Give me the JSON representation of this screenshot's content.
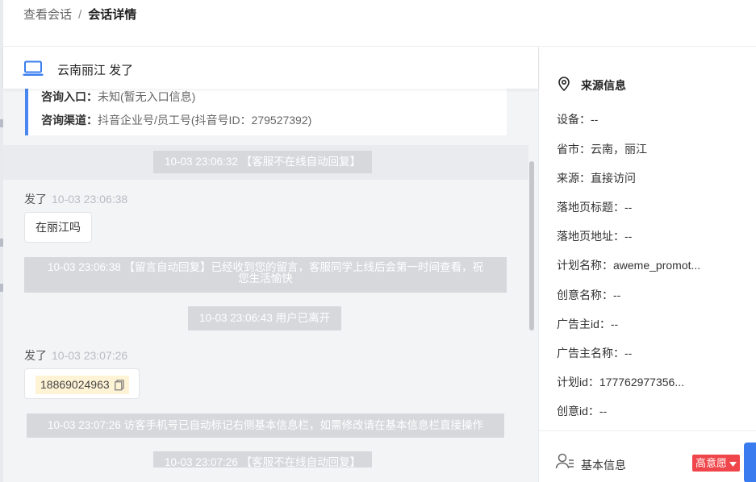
{
  "breadcrumb": {
    "parent": "查看会话",
    "separator": "/",
    "current": "会话详情"
  },
  "conversation": {
    "title": "云南丽江   发了",
    "entry_label": "咨询入口：",
    "entry_value": "未知(暂无入口信息)",
    "channel_label": "咨询渠道：",
    "channel_value": "抖音企业号/员工号(抖音号ID：279527392)",
    "messages": {
      "sys_1": "10-03 23:06:32 【客服不在线自动回复】",
      "sender_1": "发了",
      "time_1": "10-03 23:06:38",
      "bubble_1": "在丽江吗",
      "sys_2_line1": "10-03 23:06:38 【留言自动回复】已经收到您的留言，客服同学上线后会第一时间查看，祝",
      "sys_2_line2": "您生活愉快",
      "sys_3": "10-03 23:06:43 用户已离开",
      "sender_2": "发了",
      "time_2": "10-03 23:07:26",
      "phone": "18869024963",
      "sys_4": "10-03 23:07:26 访客手机号已自动标记右侧基本信息栏，如需修改请在基本信息栏直接操作",
      "sys_5": "10-03 23:07:26 【客服不在线自动回复】"
    }
  },
  "source_info": {
    "title": "来源信息",
    "device": "设备：--",
    "province_city": "省市：云南，丽江",
    "source": "来源：直接访问",
    "landing_title": "落地页标题：--",
    "landing_url": "落地页地址：--",
    "plan_name": "计划名称：aweme_promot...",
    "creative_name": "创意名称：--",
    "advertiser_id": "广告主id：--",
    "advertiser_name": "广告主名称：--",
    "plan_id": "计划id：177762977356...",
    "creative_id": "创意id：--"
  },
  "basic_info": {
    "title": "基本信息",
    "intent_badge": "高意愿",
    "intent_color": "#f0454a"
  },
  "icons": {
    "conversation": "laptop-icon",
    "source": "location-pin-icon",
    "basic": "user-icon",
    "copy": "copy-icon",
    "dropdown": "caret-down-icon"
  },
  "colors": {
    "accent": "#4a86f0",
    "panel_bg": "#f3f4f6",
    "system_message_bg": "#d6d8dc",
    "phone_highlight": "#fff3d6"
  }
}
